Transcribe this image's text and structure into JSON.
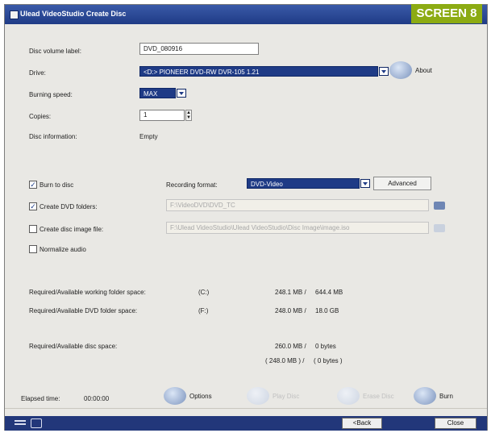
{
  "window": {
    "title": "Ulead VideoStudio Create Disc"
  },
  "badge": "SCREEN 8",
  "settings": {
    "volume_label": {
      "label": "Disc volume label:",
      "value": "DVD_080916"
    },
    "drive": {
      "label": "Drive:",
      "value": "<D:> PIONEER DVD-RW DVR-105 1.21",
      "about": "About"
    },
    "burning_speed": {
      "label": "Burning speed:",
      "value": "MAX"
    },
    "copies": {
      "label": "Copies:",
      "value": "1"
    },
    "disc_info": {
      "label": "Disc information:",
      "value": "Empty"
    }
  },
  "options": {
    "burn_to_disc": {
      "label": "Burn to disc",
      "checked": true
    },
    "recording_format": {
      "label": "Recording format:",
      "value": "DVD-Video"
    },
    "advanced_label": "Advanced",
    "create_dvd_folders": {
      "label": "Create DVD folders:",
      "checked": true,
      "path": "F:\\VideoDVD\\DVD_TC"
    },
    "create_disc_image": {
      "label": "Create disc image file:",
      "checked": false,
      "path": "F:\\Ulead VideoStudio\\Ulead VideoStudio\\Disc Image\\image.iso"
    },
    "normalize_audio": {
      "label": "Normalize audio",
      "checked": false
    }
  },
  "space": {
    "working_folder": {
      "label": "Required/Available working folder space:",
      "drive": "(C:)",
      "required": "248.1 MB /",
      "available": "644.4 MB"
    },
    "dvd_folder": {
      "label": "Required/Available DVD folder space:",
      "drive": "(F:)",
      "required": "248.0 MB /",
      "available": "18.0 GB"
    },
    "disc": {
      "label": "Required/Available disc space:",
      "required": "260.0 MB /",
      "available": "0 bytes",
      "required2": "( 248.0 MB ) /",
      "available2": "( 0 bytes )"
    }
  },
  "footer": {
    "elapsed_label": "Elapsed time:",
    "elapsed_value": "00:00:00",
    "options_label": "Options",
    "play_label": "Play Disc",
    "erase_label": "Erase Disc",
    "burn_label": "Burn",
    "back_label": "<Back",
    "close_label": "Close"
  }
}
